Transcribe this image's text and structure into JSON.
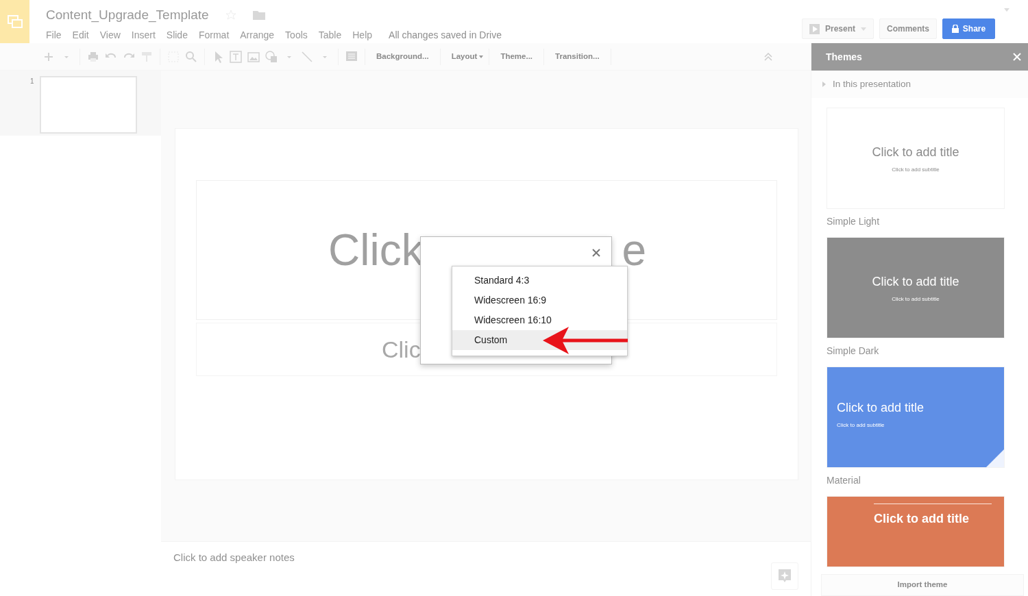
{
  "app": {
    "doc_title": "Content_Upgrade_Template",
    "menu": [
      "File",
      "Edit",
      "View",
      "Insert",
      "Slide",
      "Format",
      "Arrange",
      "Tools",
      "Table",
      "Help"
    ],
    "save_status": "All changes saved in Drive"
  },
  "header_buttons": {
    "present": "Present",
    "comments": "Comments",
    "share": "Share"
  },
  "toolbar": {
    "text_buttons": [
      {
        "label": "Background...",
        "dropdown": false
      },
      {
        "label": "Layout",
        "dropdown": true
      },
      {
        "label": "Theme...",
        "dropdown": false
      },
      {
        "label": "Transition...",
        "dropdown": false
      }
    ]
  },
  "filmstrip": [
    {
      "number": "1"
    }
  ],
  "slide": {
    "title_fragments": [
      "Click",
      "e"
    ],
    "subtitle_fragment": "Clic"
  },
  "notes": {
    "placeholder": "Click to add speaker notes"
  },
  "themes_panel": {
    "title": "Themes",
    "section": "In this presentation",
    "themes": [
      {
        "kind": "light",
        "name": "Simple Light",
        "title": "Click to add title",
        "subtitle": "Click to add subtitle"
      },
      {
        "kind": "dark",
        "name": "Simple Dark",
        "title": "Click to add title",
        "subtitle": "Click to add subtitle"
      },
      {
        "kind": "material",
        "name": "Material",
        "title": "Click to add title",
        "subtitle": "Click to add subtitle"
      },
      {
        "kind": "coral",
        "title": "Click to add title"
      }
    ],
    "import": "Import theme"
  },
  "dialog": {
    "options": [
      {
        "label": "Standard 4:3",
        "selected": false
      },
      {
        "label": "Widescreen 16:9",
        "selected": false
      },
      {
        "label": "Widescreen 16:10",
        "selected": false
      },
      {
        "label": "Custom",
        "selected": true
      }
    ]
  }
}
